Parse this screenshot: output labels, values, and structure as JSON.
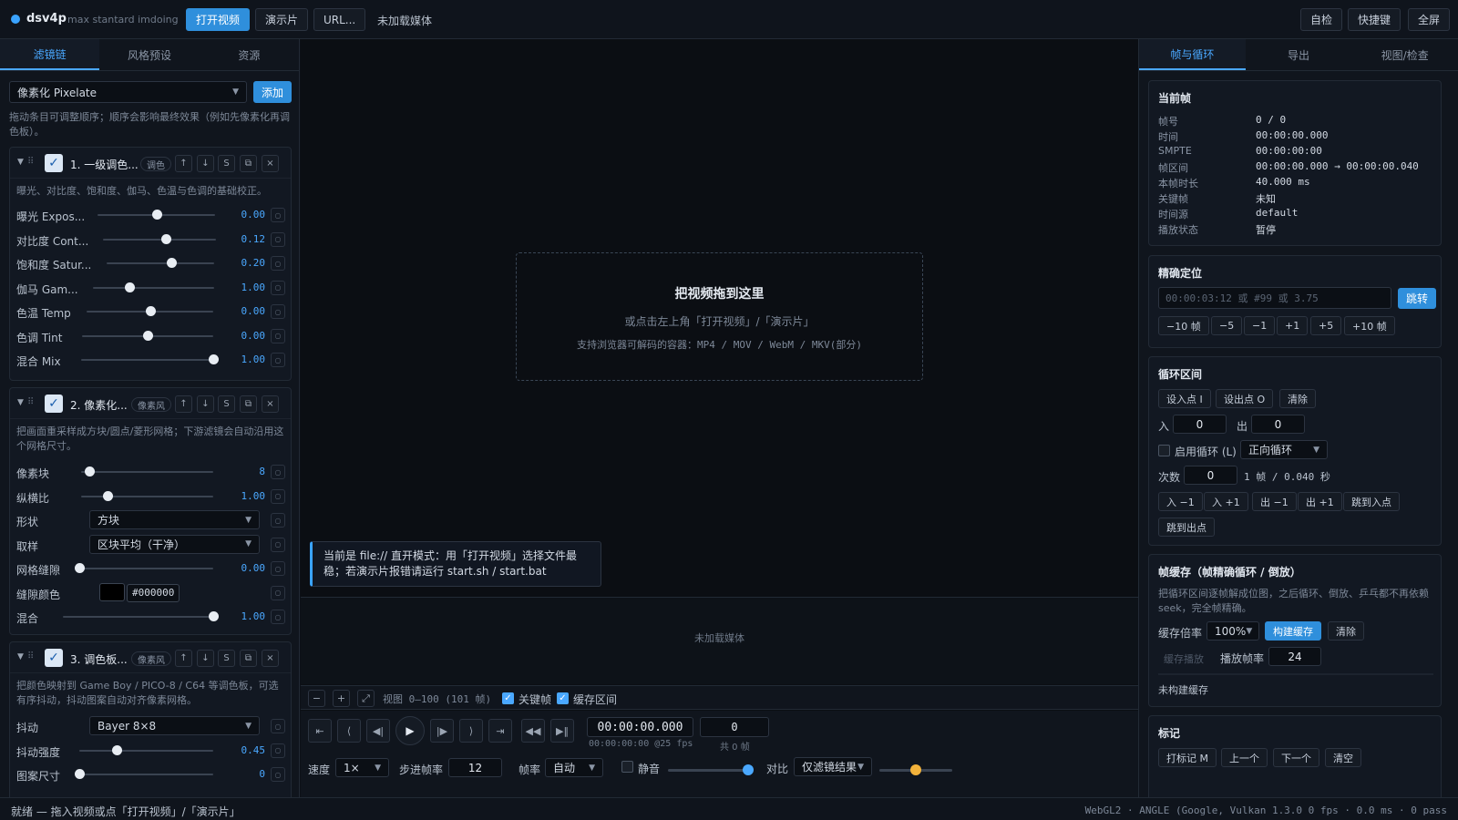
{
  "app": {
    "name": "dsv4p",
    "subtitle": "max stantard imdoing"
  },
  "topbar": {
    "open_video": "打开视频",
    "demo": "演示片",
    "url": "URL...",
    "media_status": "未加载媒体",
    "selfcheck": "自检",
    "shortcuts": "快捷键",
    "fullscreen": "全屏"
  },
  "left": {
    "tabs": [
      "滤镜链",
      "风格预设",
      "资源"
    ],
    "filter_select": "像素化 Pixelate",
    "add": "添加",
    "hint": "拖动条目可调整顺序；顺序会影响最终效果（例如先像素化再调色板）。",
    "cards": [
      {
        "title": "1. 一级调色...",
        "tag": "调色",
        "desc": "曝光、对比度、饱和度、伽马、色温与色调的基础校正。",
        "params": [
          {
            "label": "曝光 Expos...",
            "value": "0.00",
            "pos": 0.5
          },
          {
            "label": "对比度 Cont...",
            "value": "0.12",
            "pos": 0.56
          },
          {
            "label": "饱和度 Satur...",
            "value": "0.20",
            "pos": 0.6
          },
          {
            "label": "伽马 Gam...",
            "value": "1.00",
            "pos": 0.3
          },
          {
            "label": "色温 Temp",
            "value": "0.00",
            "pos": 0.5
          },
          {
            "label": "色调 Tint",
            "value": "0.00",
            "pos": 0.5
          },
          {
            "label": "混合 Mix",
            "value": "1.00",
            "pos": 1.0
          }
        ]
      },
      {
        "title": "2. 像素化...",
        "tag": "像素风",
        "desc": "把画面重采样成方块/圆点/菱形网格；下游滤镜会自动沿用这个网格尺寸。",
        "params": [
          {
            "label": "像素块",
            "value": "8",
            "pos": 0.06
          },
          {
            "label": "纵横比",
            "value": "1.00",
            "pos": 0.2
          },
          {
            "label": "形状",
            "select": "方块"
          },
          {
            "label": "取样",
            "select": "区块平均（干净）"
          },
          {
            "label": "网格缝隙",
            "value": "0.00",
            "pos": 0.0
          },
          {
            "label": "缝隙颜色",
            "color": "#000000"
          },
          {
            "label": "混合",
            "value": "1.00",
            "pos": 1.0
          }
        ]
      },
      {
        "title": "3. 调色板...",
        "tag": "像素风",
        "desc": "把颜色映射到 Game Boy / PICO-8 / C64 等调色板，可选有序抖动，抖动图案自动对齐像素网格。",
        "params": [
          {
            "label": "抖动",
            "select": "Bayer 8×8"
          },
          {
            "label": "抖动强度",
            "value": "0.45",
            "pos": 0.28
          },
          {
            "label": "图案尺寸",
            "value": "0",
            "pos": 0.0
          }
        ]
      }
    ]
  },
  "center": {
    "drop_title": "把视频拖到这里",
    "drop_sub1": "或点击左上角「打开视频」/「演示片」",
    "drop_sub2": "支持浏览器可解码的容器：MP4 / MOV / WebM / MKV(部分)",
    "note": "当前是 file:// 直开模式：用「打开视频」选择文件最稳；若演示片报错请运行 start.sh / start.bat",
    "timeline_empty": "未加载媒体",
    "view_range": "视图 0–100 (101 帧)",
    "keyframe": "关键帧",
    "cache_range": "缓存区间",
    "timecode": "00:00:00.000",
    "timecode_sub": "00:00:00:00 @25 fps",
    "frame_value": "0",
    "frame_total": "共 0 帧",
    "speed_label": "速度",
    "speed": "1×",
    "step_fps_label": "步进帧率",
    "step_fps": "12",
    "fps_label": "帧率",
    "fps": "自动",
    "mute": "静音",
    "volume": 1.0,
    "compare_label": "对比",
    "compare": "仅滤镜结果",
    "compare_pos": 0.5
  },
  "right": {
    "tabs": [
      "帧与循环",
      "导出",
      "视图/检查"
    ],
    "current_frame": {
      "title": "当前帧",
      "rows": [
        {
          "k": "帧号",
          "v": "0 / 0"
        },
        {
          "k": "时间",
          "v": "00:00:00.000"
        },
        {
          "k": "SMPTE",
          "v": "00:00:00:00"
        },
        {
          "k": "帧区间",
          "v": "00:00:00.000 → 00:00:00.040"
        },
        {
          "k": "本帧时长",
          "v": "40.000 ms"
        },
        {
          "k": "关键帧",
          "v": "未知"
        },
        {
          "k": "时间源",
          "v": "default"
        },
        {
          "k": "播放状态",
          "v": "暂停"
        }
      ]
    },
    "seek": {
      "title": "精确定位",
      "placeholder": "00:00:03:12 或 #99 或 3.75",
      "go": "跳转",
      "steps": [
        "−10 帧",
        "−5",
        "−1",
        "+1",
        "+5",
        "+10 帧"
      ]
    },
    "loop": {
      "title": "循环区间",
      "set_in": "设入点 I",
      "set_out": "设出点 O",
      "clear": "清除",
      "in_label": "入",
      "in_value": "0",
      "out_label": "出",
      "out_value": "0",
      "enable": "启用循环 (L)",
      "mode": "正向循环",
      "count_label": "次数",
      "count": "0",
      "count_info": "1 帧 / 0.040 秒",
      "buttons": [
        "入 −1",
        "入 +1",
        "出 −1",
        "出 +1",
        "跳到入点"
      ],
      "goto_out": "跳到出点"
    },
    "cache": {
      "title": "帧缓存（帧精确循环 / 倒放）",
      "desc": "把循环区间逐帧解成位图，之后循环、倒放、乒乓都不再依赖 seek，完全帧精确。",
      "rate_label": "缓存倍率",
      "rate": "100%",
      "build": "构建缓存",
      "clear": "清除",
      "play": "缓存播放",
      "fps_label": "播放帧率",
      "fps": "24",
      "status": "未构建缓存"
    },
    "marks": {
      "title": "标记",
      "buttons": [
        "打标记 M",
        "上一个",
        "下一个",
        "清空"
      ]
    }
  },
  "status": {
    "left": "就绪 — 拖入视频或点「打开视频」/「演示片」",
    "right": "WebGL2 · ANGLE (Google, Vulkan 1.3.0 0 fps · 0.0 ms · 0 pass"
  },
  "colors": {
    "accent": "#4aa8ff",
    "primary_button": "#2f8fdc",
    "background": "#0c1017"
  }
}
